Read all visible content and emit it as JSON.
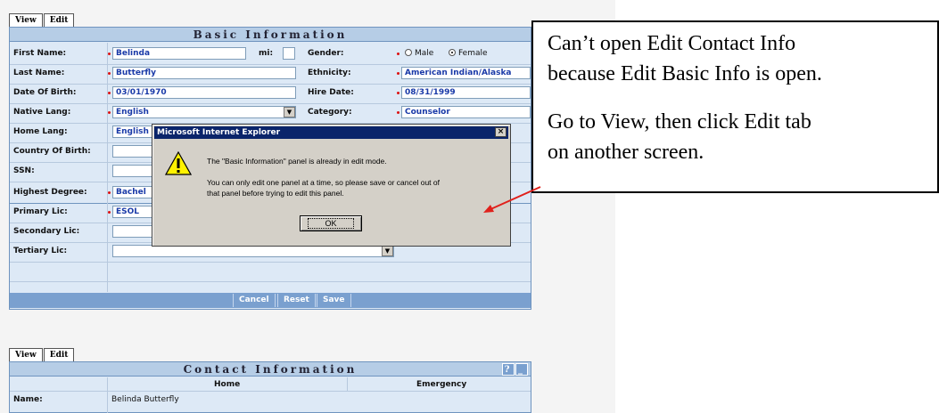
{
  "tabs_top": {
    "view": "View",
    "edit": "Edit"
  },
  "basic": {
    "title": "Basic Information",
    "first_name_label": "First Name:",
    "first_name": "Belinda",
    "mi_label": "mi:",
    "mi": "",
    "last_name_label": "Last Name:",
    "last_name": "Butterfly",
    "dob_label": "Date Of Birth:",
    "dob": "03/01/1970",
    "native_lang_label": "Native Lang:",
    "native_lang": "English",
    "home_lang_label": "Home Lang:",
    "home_lang": "English",
    "country_label": "Country Of Birth:",
    "country": "",
    "ssn_label": "SSN:",
    "ssn": "",
    "highest_degree_label": "Highest Degree:",
    "highest_degree": "Bachel",
    "primary_lic_label": "Primary Lic:",
    "primary_lic": "ESOL",
    "secondary_lic_label": "Secondary Lic:",
    "secondary_lic": "",
    "tertiary_lic_label": "Tertiary Lic:",
    "tertiary_lic": "",
    "gender_label": "Gender:",
    "male": "Male",
    "female": "Female",
    "ethnicity_label": "Ethnicity:",
    "ethnicity": "American Indian/Alaska",
    "hire_date_label": "Hire Date:",
    "hire_date": "08/31/1999",
    "category_label": "Category:",
    "category": "Counselor"
  },
  "buttons": {
    "cancel": "Cancel",
    "reset": "Reset",
    "save": "Save"
  },
  "dialog": {
    "title": "Microsoft Internet Explorer",
    "close": "×",
    "line1": "The \"Basic Information\" panel is already in edit mode.",
    "line2": "You can only edit one panel at a time, so please save or cancel out of",
    "line3": "that panel before trying to edit this panel.",
    "ok": "OK"
  },
  "callout": {
    "line1": "Can’t open Edit Contact Info",
    "line2": "because Edit Basic Info is open.",
    "line3": "Go to View, then click Edit tab",
    "line4": "on another screen."
  },
  "tabs_bottom": {
    "view": "View",
    "edit": "Edit"
  },
  "contact": {
    "title": "Contact Information",
    "help": "?",
    "minimize": "_",
    "col_home": "Home",
    "col_emergency": "Emergency",
    "name_label": "Name:",
    "name_home": "Belinda Butterfly"
  },
  "icons": {
    "warning": "warning-icon",
    "arrow": "red-arrow"
  }
}
